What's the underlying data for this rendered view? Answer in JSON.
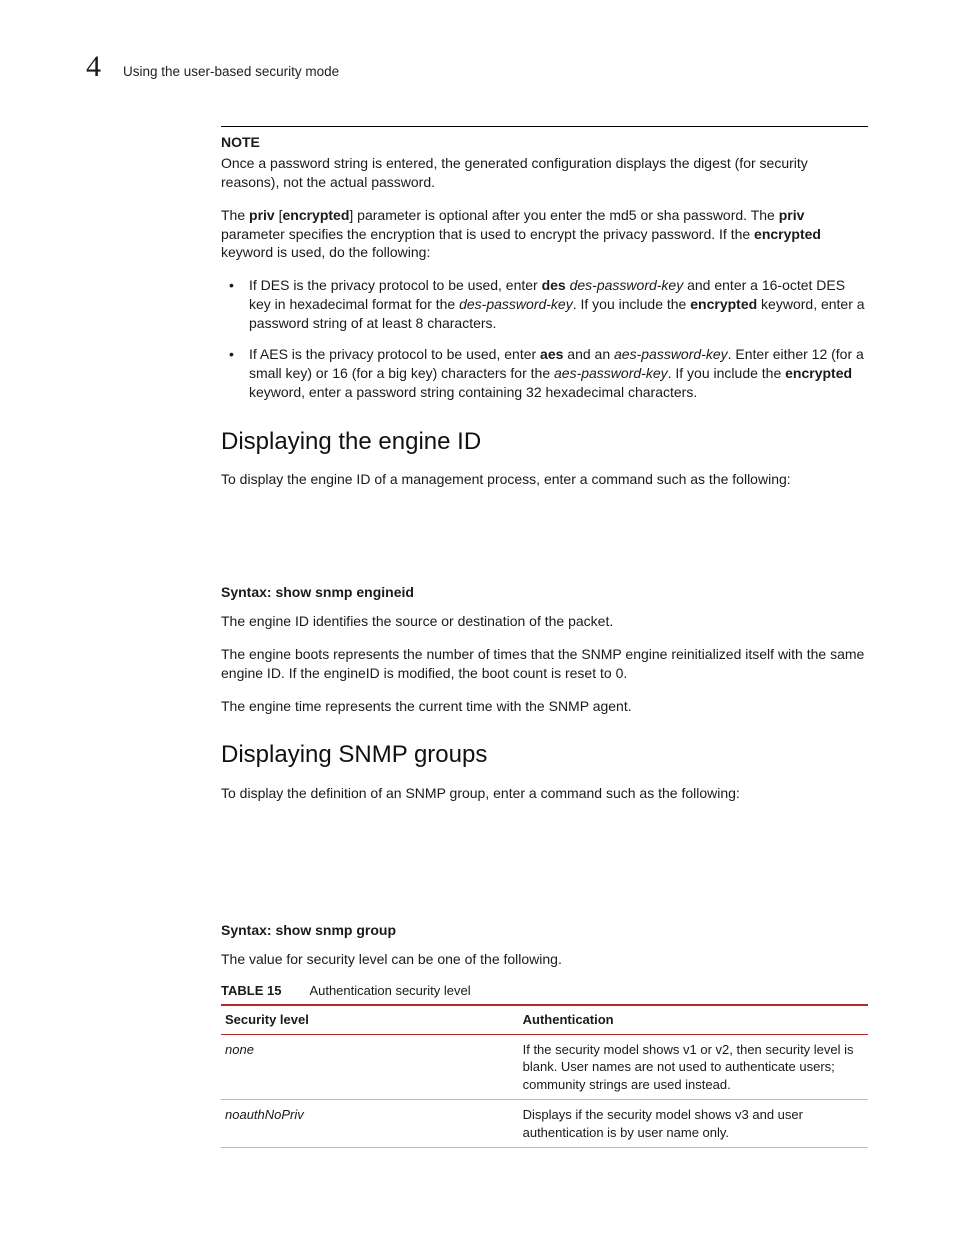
{
  "header": {
    "chapter_num": "4",
    "running_head": "Using the user-based security mode"
  },
  "note": {
    "label": "NOTE",
    "text": "Once a password string is entered, the generated configuration displays the digest (for security reasons), not the actual password."
  },
  "priv_para": {
    "lead": "The ",
    "priv1": "priv",
    "brL": " [",
    "enc1": "encrypted",
    "brR": "] parameter is optional after you enter the md5 or sha password. The ",
    "priv2": "priv",
    "mid": " parameter specifies the encryption that is used to encrypt the privacy password. If the ",
    "enc2": "encrypted",
    "tail": " keyword is used, do the following:"
  },
  "bullets": [
    {
      "pre": "If DES is the privacy protocol to be used, enter ",
      "b1": "des",
      "sp1": " ",
      "i1": "des-password-key",
      "mid1": " and enter a 16-octet DES key in hexadecimal format for the ",
      "i2": "des-password-key",
      "mid2": ". If you include the ",
      "b2": "encrypted",
      "tail": " keyword, enter a password string of at least 8 characters."
    },
    {
      "pre": "If AES is the privacy protocol to be used, enter ",
      "b1": "aes",
      "mid1": " and an ",
      "i1": "aes-password-key",
      "mid2": ". Enter either 12 (for a small key) or 16 (for a big key) characters for the ",
      "i2": "aes-password-key",
      "mid3": ". If you include the ",
      "b2": "encrypted",
      "tail": " keyword, enter a password string containing 32 hexadecimal characters."
    }
  ],
  "section1": {
    "heading": "Displaying the engine ID",
    "intro": "To display the engine ID of a management process, enter a command such as the following:",
    "syntax_label": "Syntax:",
    "syntax_cmd": "  show snmp engineid",
    "p1": "The engine ID identifies the source or destination of the packet.",
    "p2": "The engine boots represents the number of times that the SNMP engine reinitialized itself with the same engine ID. If the engineID is modified, the boot count is reset to 0.",
    "p3": "The engine time represents the current time with the SNMP agent."
  },
  "section2": {
    "heading": "Displaying SNMP groups",
    "intro": "To display the definition of an SNMP group, enter a command such as the following:",
    "syntax_label": "Syntax:",
    "syntax_cmd": "  show snmp group",
    "p1": "The value for security level can be one of the following."
  },
  "table": {
    "label": "TABLE 15",
    "title": "Authentication security level",
    "col1": "Security level",
    "col2": "Authentication",
    "rows": [
      {
        "level": "none",
        "auth": "If the security model shows v1 or v2, then security level is blank. User names are not used to authenticate users; community strings are used instead."
      },
      {
        "level": "noauthNoPriv",
        "auth": "Displays if the security model shows v3 and user authentication is by user name only."
      }
    ]
  },
  "chart_data": {
    "type": "table",
    "title": "Authentication security level",
    "columns": [
      "Security level",
      "Authentication"
    ],
    "rows": [
      [
        "none",
        "If the security model shows v1 or v2, then security level is blank. User names are not used to authenticate users; community strings are used instead."
      ],
      [
        "noauthNoPriv",
        "Displays if the security model shows v3 and user authentication is by user name only."
      ]
    ]
  }
}
